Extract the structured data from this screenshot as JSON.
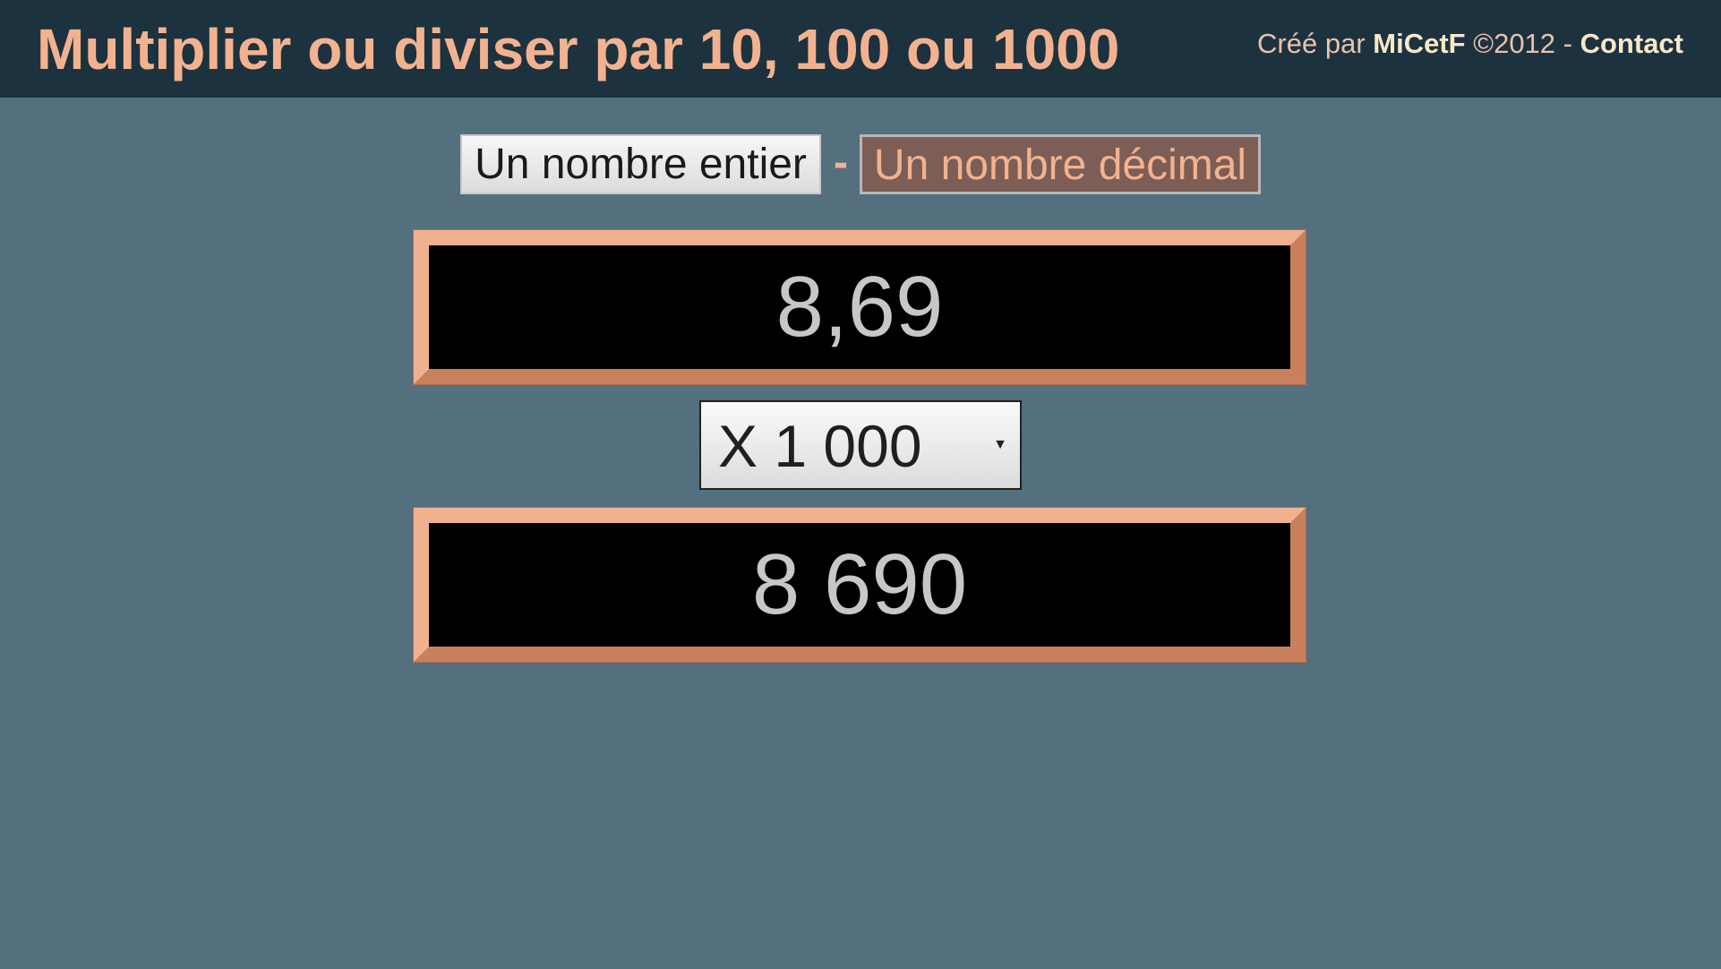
{
  "header": {
    "title": "Multiplier ou diviser par 10, 100 ou 1000",
    "credits_prefix": "Créé par",
    "author": "MiCetF",
    "copyright": "©2012 -",
    "contact_label": "Contact"
  },
  "mode": {
    "integer_label": "Un nombre entier",
    "separator": "-",
    "decimal_label": "Un nombre décimal",
    "selected": "decimal"
  },
  "calculator": {
    "input_value": "8,69",
    "operation": {
      "selected": "X 1 000",
      "arrow_icon": "dropdown-arrow-icon"
    },
    "result_value": "8 690"
  },
  "colors": {
    "background": "#546f7e",
    "header_background": "#1d323f",
    "accent": "#f3b28f",
    "selected_button": "#7c5e56",
    "display_background": "#000000",
    "display_text": "#c7c7c7"
  }
}
